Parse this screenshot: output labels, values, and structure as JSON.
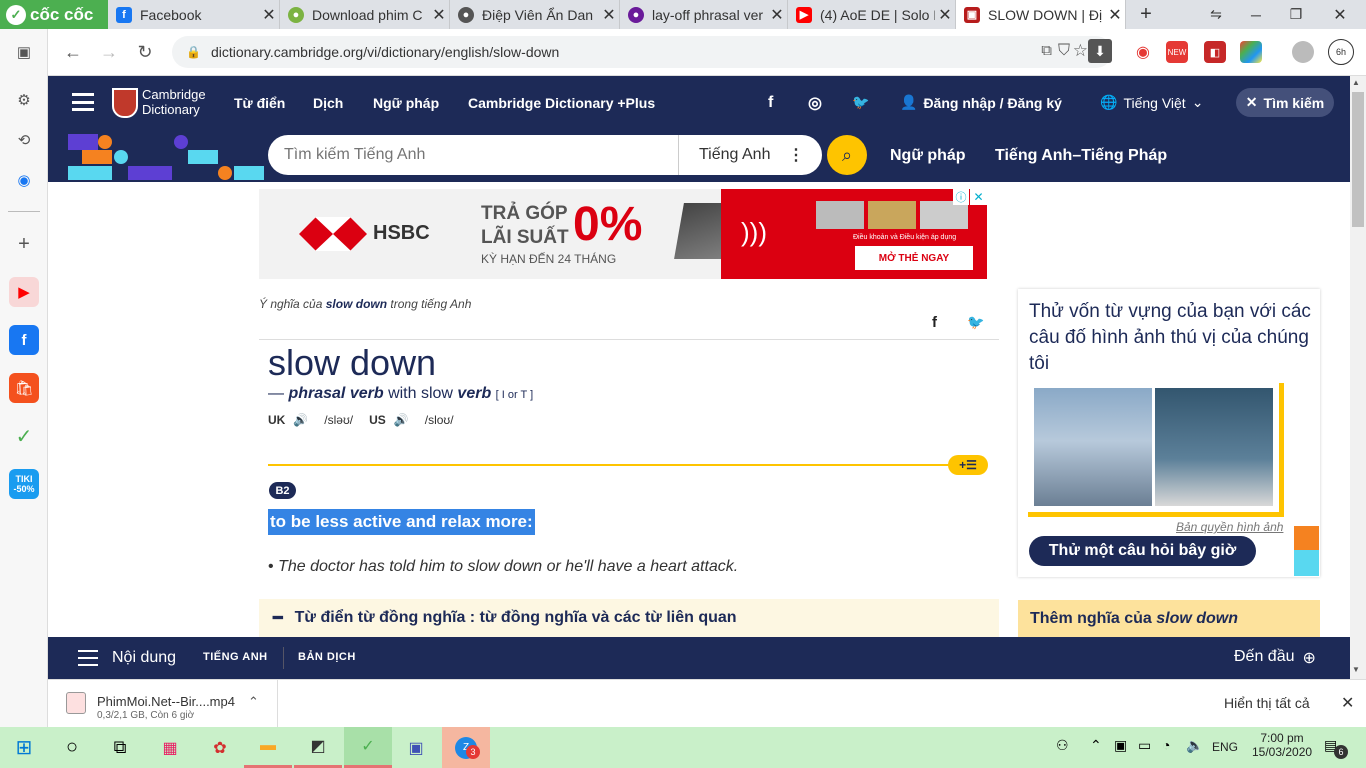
{
  "browser": {
    "brand": "cốc cốc",
    "tabs": [
      {
        "title": "Facebook",
        "icon": "facebook-icon",
        "color": "#1877f2"
      },
      {
        "title": "Download phim C",
        "icon": "film-icon",
        "color": "#7cb342"
      },
      {
        "title": "Điệp Viên Ẩn Dan",
        "icon": "film-icon",
        "color": "#555555"
      },
      {
        "title": "lay-off phrasal ver",
        "icon": "book-icon",
        "color": "#6a1b9a"
      },
      {
        "title": "(4) AoE DE | Solo F",
        "icon": "youtube-icon",
        "color": "#ff0000"
      },
      {
        "title": "SLOW DOWN | Đị",
        "icon": "cambridge-icon",
        "color": "#b71c1c"
      }
    ],
    "url": "dictionary.cambridge.org/vi/dictionary/english/slow-down"
  },
  "cambridge": {
    "logo_line1": "Cambridge",
    "logo_line2": "Dictionary",
    "nav": [
      "Từ điển",
      "Dịch",
      "Ngữ pháp",
      "Cambridge Dictionary +Plus"
    ],
    "login": "Đăng nhập / Đăng ký",
    "language": "Tiếng Việt",
    "search_btn": "Tìm kiếm",
    "search_placeholder": "Tìm kiếm Tiếng Anh",
    "search_lang": "Tiếng Anh",
    "sub_links": [
      "Ngữ pháp",
      "Tiếng Anh–Tiếng Pháp"
    ]
  },
  "ad": {
    "brand": "HSBC",
    "line1": "TRẢ GÓP",
    "line2": "LÃI SUẤT",
    "rate": "0%",
    "line3": "KỲ HẠN ĐẾN 24 THÁNG",
    "terms": "Điều khoản và Điều kiện áp dụng",
    "cta": "MỞ THẺ NGAY"
  },
  "entry": {
    "meaning_prefix": "Ý nghĩa của",
    "meaning_word": "slow down",
    "meaning_suffix": "trong tiếng Anh",
    "headword": "slow down",
    "dash": "—",
    "pos": "phrasal verb",
    "with": "with slow",
    "verb": "verb",
    "grammar": "[ I or T ]",
    "uk": "UK",
    "uk_ipa": "/sləʊ/",
    "us": "US",
    "us_ipa": "/sloʊ/",
    "level": "B2",
    "definition": "to be less active and relax more:",
    "example": "The doctor has told him to slow down or he'll have a heart attack.",
    "thesaurus": "Từ điển từ đồng nghĩa : từ đồng nghĩa và các từ liên quan"
  },
  "sidebar_panel": {
    "quiz_text": "Thử vốn từ vựng của bạn với các câu đố hình ảnh thú vị của chúng tôi",
    "credit": "Bản quyền hình ảnh",
    "quiz_button": "Thử một câu hỏi bây giờ",
    "more_prefix": "Thêm nghĩa của",
    "more_word": "slow down"
  },
  "bottom_bar": {
    "contents": "Nội dung",
    "tab1": "TIẾNG ANH",
    "tab2": "BẢN DỊCH",
    "top": "Đến đầu"
  },
  "download": {
    "filename": "PhimMoi.Net--Bir....mp4",
    "status": "0,3/2,1 GB, Còn 6 giờ",
    "show_all": "Hiển thị tất cả"
  },
  "taskbar": {
    "lang": "ENG",
    "time": "7:00 pm",
    "date": "15/03/2020",
    "notif_count": "6",
    "zalo_badge": "3"
  },
  "tiki": {
    "line1": "TIKI",
    "line2": "-50%"
  }
}
